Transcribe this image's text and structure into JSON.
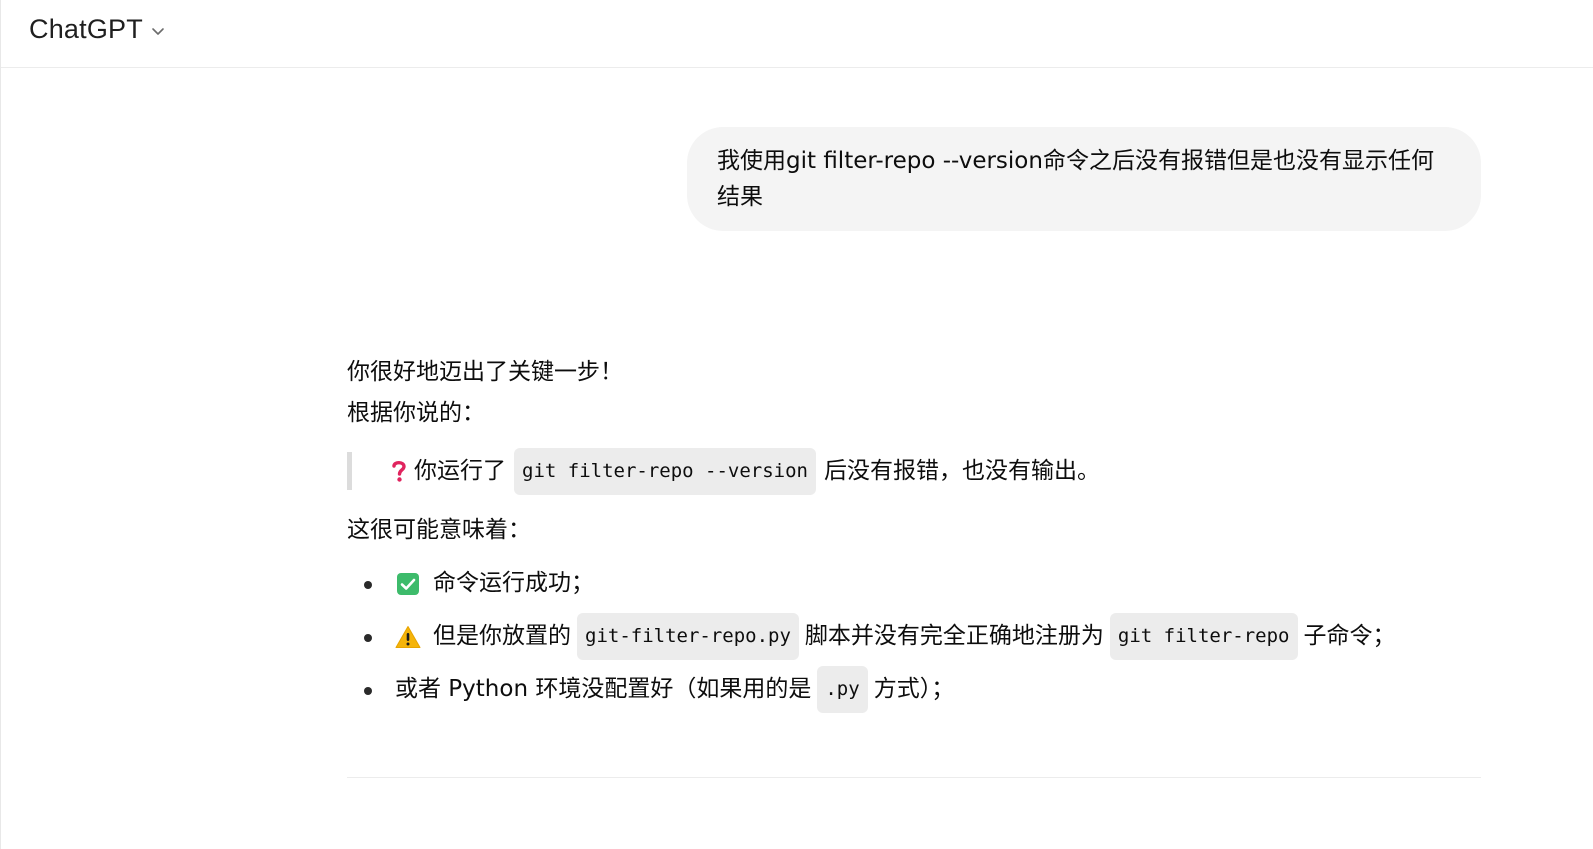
{
  "header": {
    "model_name": "ChatGPT"
  },
  "conversation": {
    "user_message": "我使用git filter-repo --version命令之后没有报错但是也没有显示任何结果",
    "assistant": {
      "line1": "你很好地迈出了关键一步！",
      "line2": "根据你说的：",
      "quote": {
        "prefix": "你运行了",
        "code": "git filter-repo --version",
        "suffix": "后没有报错，也没有输出。"
      },
      "meaning_intro": "这很可能意味着：",
      "points": [
        {
          "text": "命令运行成功；"
        },
        {
          "prefix": "但是你放置的",
          "code1": "git-filter-repo.py",
          "middle": "脚本并没有完全正确地注册为",
          "code2": "git filter-repo",
          "suffix": "子命令；"
        },
        {
          "prefix": "或者 Python 环境没配置好（如果用的是",
          "code": ".py",
          "suffix": "方式）；"
        }
      ]
    }
  },
  "icons": {
    "model_chevron": "chevron-down-icon",
    "quote_emoji": "red-question-mark-icon",
    "point1_emoji": "check-mark-button-icon",
    "point2_emoji": "warning-icon"
  },
  "colors": {
    "user_bubble_bg": "#f4f4f4",
    "code_bg": "#ececec",
    "check_green": "#3dbb6b",
    "warning_yellow": "#f5b40a",
    "question_red": "#e0245e"
  }
}
